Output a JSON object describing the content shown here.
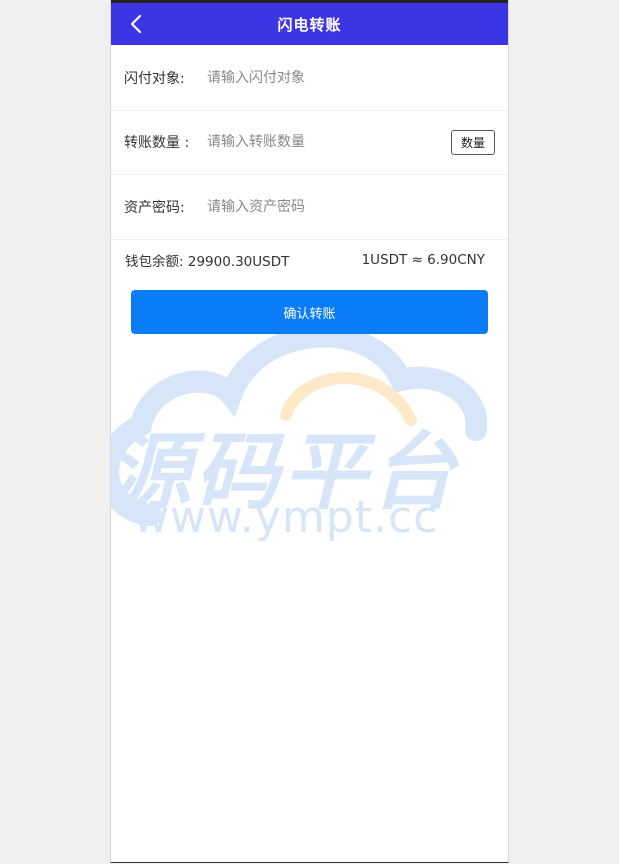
{
  "header": {
    "title": "闪电转账"
  },
  "form": {
    "target": {
      "label": "闪付对象:",
      "placeholder": "请输入闪付对象",
      "value": ""
    },
    "amount": {
      "label": "转账数量 :",
      "placeholder": "请输入转账数量",
      "value": "",
      "button_label": "数量"
    },
    "password": {
      "label": "资产密码:",
      "placeholder": "请输入资产密码",
      "value": ""
    }
  },
  "balance": {
    "label": "钱包余额:",
    "value": "29900.30USDT",
    "rate": "1USDT ≈ 6.90CNY"
  },
  "confirm": {
    "label": "确认转账"
  },
  "watermark": {
    "cn": "源码平台",
    "en": "www.ympt.cc"
  },
  "colors": {
    "header_bg": "#3c35e4",
    "button_bg": "#0a7cf6",
    "watermark_blue": "#d3e3f9",
    "watermark_orange": "#fde7c3"
  },
  "icons": {
    "back": "chevron-left-icon",
    "watermark": "cloud-logo-icon"
  }
}
